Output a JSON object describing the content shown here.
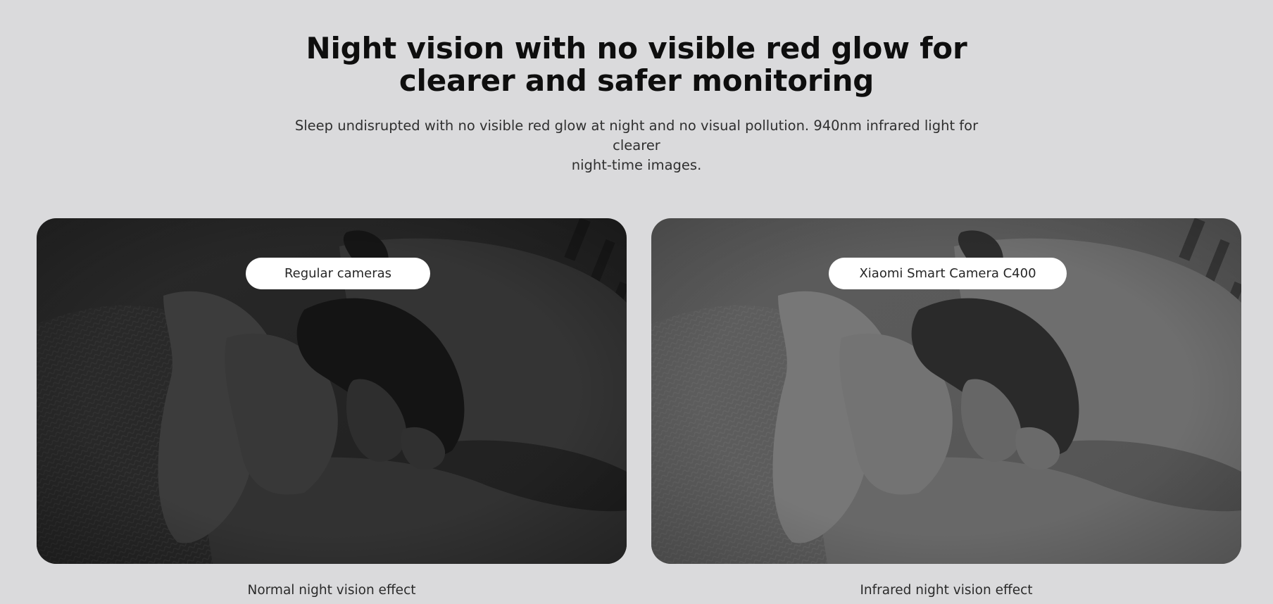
{
  "header": {
    "title_line1": "Night vision with no visible red glow for",
    "title_line2": "clearer and safer monitoring",
    "subtitle_line1": "Sleep undisrupted with no visible red glow at night and no visual pollution. 940nm infrared light for clearer",
    "subtitle_line2": "night-time images."
  },
  "comparison": {
    "left": {
      "label": "Regular cameras",
      "caption": "Normal night vision effect",
      "image": "dark-night-vision-sleeping-child"
    },
    "right": {
      "label": "Xiaomi Smart Camera C400",
      "caption": "Infrared night vision effect",
      "image": "bright-infrared-sleeping-child"
    }
  },
  "colors": {
    "background": "#dadadc",
    "label_pill": "#ffffff",
    "regular_scene_tone": "#262626",
    "infrared_scene_tone": "#5e5e5e"
  }
}
